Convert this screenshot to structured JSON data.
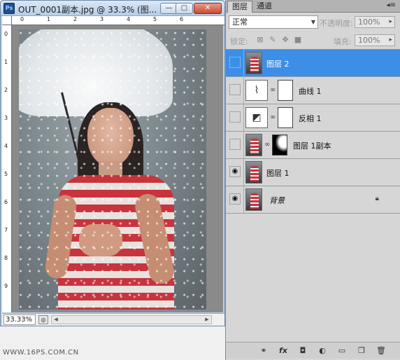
{
  "document_window": {
    "title": "OUT_0001副本.jpg @ 33.3% (图...",
    "app_icon": "Ps",
    "buttons": {
      "minimize": "—",
      "maximize": "▢",
      "close": "✕"
    },
    "ruler_top_labels": [
      "0",
      "1",
      "2",
      "3",
      "4",
      "5",
      "6"
    ],
    "ruler_left_labels": [
      "0",
      "1",
      "2",
      "3",
      "4",
      "5",
      "6",
      "7",
      "8",
      "9"
    ],
    "zoom": "33.33%",
    "status_icon": "status-menu-icon"
  },
  "layers_panel": {
    "tabs": [
      {
        "label": "图层"
      },
      {
        "label": "通道"
      }
    ],
    "menu_icon": "◂≡",
    "blend_mode": "正常",
    "opacity_label": "不透明度:",
    "opacity_value": "100%",
    "lock_label": "锁定:",
    "fill_label": "填充:",
    "fill_value": "100%",
    "layers": [
      {
        "name": "图层 2",
        "visible": false,
        "selected": true
      },
      {
        "name": "曲线 1",
        "visible": false,
        "selected": false
      },
      {
        "name": "反相 1",
        "visible": false,
        "selected": false
      },
      {
        "name": "图层 1副本",
        "visible": false,
        "selected": false
      },
      {
        "name": "图层 1",
        "visible": true,
        "selected": false
      },
      {
        "name": "背景",
        "visible": true,
        "selected": false,
        "locked": true
      }
    ],
    "bottom_icons": [
      "link-icon",
      "fx-icon",
      "mask-icon",
      "adjustment-icon",
      "group-folder-icon",
      "new-layer-icon",
      "trash-icon"
    ]
  },
  "watermark": "WWW.16PS.COM.CN"
}
